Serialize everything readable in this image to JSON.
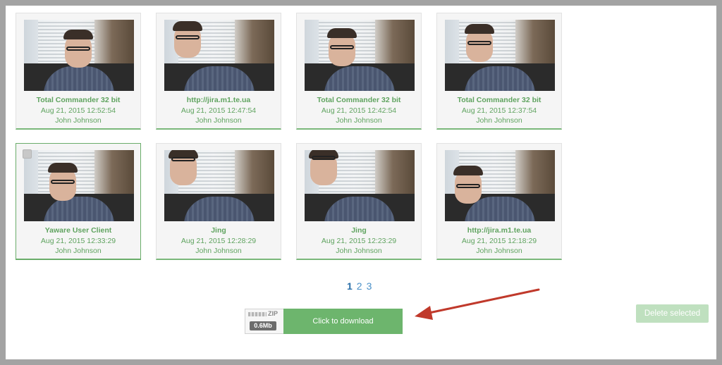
{
  "cards": [
    {
      "title": "Total Commander 32 bit",
      "date": "Aug 21, 2015 12:52:54",
      "user": "John Johnson"
    },
    {
      "title": "http://jira.m1.te.ua",
      "date": "Aug 21, 2015 12:47:54",
      "user": "John Johnson"
    },
    {
      "title": "Total Commander 32 bit",
      "date": "Aug 21, 2015 12:42:54",
      "user": "John Johnson"
    },
    {
      "title": "Total Commander 32 bit",
      "date": "Aug 21, 2015 12:37:54",
      "user": "John Johnson"
    },
    {
      "title": "Yaware User Client",
      "date": "Aug 21, 2015 12:33:29",
      "user": "John Johnson"
    },
    {
      "title": "Jing",
      "date": "Aug 21, 2015 12:28:29",
      "user": "John Johnson"
    },
    {
      "title": "Jing",
      "date": "Aug 21, 2015 12:23:29",
      "user": "John Johnson"
    },
    {
      "title": "http://jira.m1.te.ua",
      "date": "Aug 21, 2015 12:18:29",
      "user": "John Johnson"
    }
  ],
  "pagination": {
    "pages": [
      "1",
      "2",
      "3"
    ],
    "current": "1"
  },
  "download": {
    "zip_label": "ZIP",
    "size": "0.6Mb",
    "button_label": "Click to download"
  },
  "actions": {
    "delete_label": "Delete selected"
  },
  "colors": {
    "accent_green": "#6db56d",
    "text_green": "#5fa35f",
    "link_blue": "#4a90c8",
    "arrow_red": "#c0392b"
  }
}
